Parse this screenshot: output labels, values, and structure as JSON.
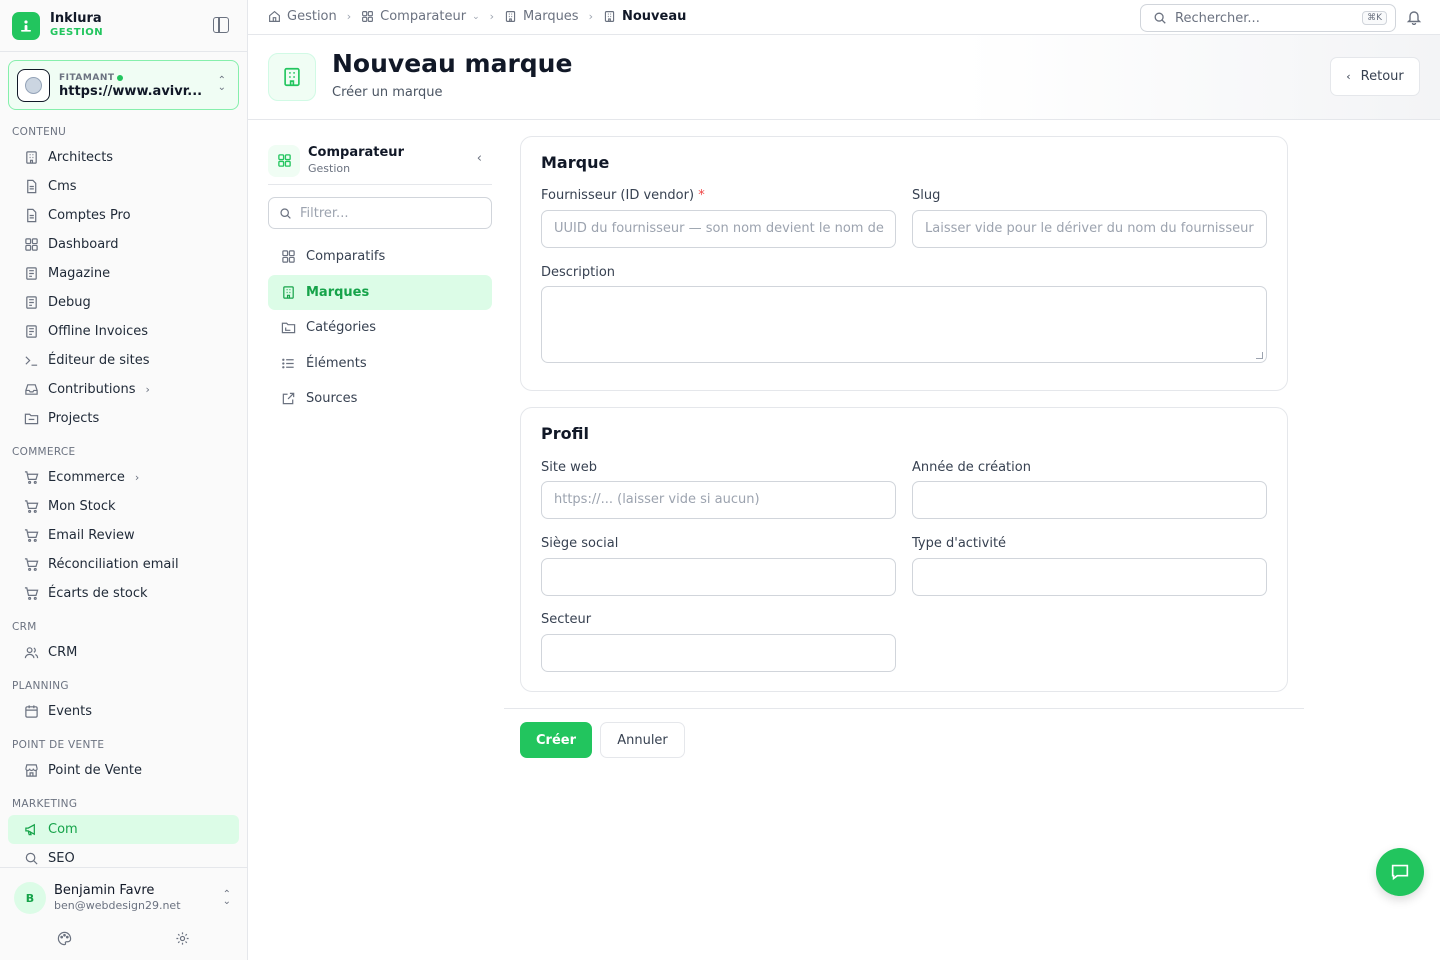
{
  "brand": {
    "name": "Inklura",
    "sub": "GESTION"
  },
  "tenant": {
    "label": "FITAMANT",
    "url": "https://www.avivr..."
  },
  "sidebar": {
    "sections": [
      {
        "label": "CONTENU",
        "items": [
          {
            "label": "Architects",
            "icon": "building-icon"
          },
          {
            "label": "Cms",
            "icon": "file-icon"
          },
          {
            "label": "Comptes Pro",
            "icon": "file-icon"
          },
          {
            "label": "Dashboard",
            "icon": "grid-icon"
          },
          {
            "label": "Magazine",
            "icon": "newspaper-icon"
          },
          {
            "label": "Debug",
            "icon": "newspaper-icon"
          },
          {
            "label": "Offline Invoices",
            "icon": "newspaper-icon"
          },
          {
            "label": "Éditeur de sites",
            "icon": "terminal-icon"
          },
          {
            "label": "Contributions",
            "icon": "inbox-icon",
            "has_children": true
          },
          {
            "label": "Projects",
            "icon": "folder-icon"
          }
        ]
      },
      {
        "label": "COMMERCE",
        "items": [
          {
            "label": "Ecommerce",
            "icon": "cart-icon",
            "has_children": true
          },
          {
            "label": "Mon Stock",
            "icon": "cart-icon"
          },
          {
            "label": "Email Review",
            "icon": "cart-icon"
          },
          {
            "label": "Réconciliation email",
            "icon": "cart-icon"
          },
          {
            "label": "Écarts de stock",
            "icon": "cart-icon"
          }
        ]
      },
      {
        "label": "CRM",
        "items": [
          {
            "label": "CRM",
            "icon": "users-icon"
          }
        ]
      },
      {
        "label": "PLANNING",
        "items": [
          {
            "label": "Events",
            "icon": "calendar-icon"
          }
        ]
      },
      {
        "label": "POINT DE VENTE",
        "items": [
          {
            "label": "Point de Vente",
            "icon": "store-icon"
          }
        ]
      },
      {
        "label": "MARKETING",
        "items": [
          {
            "label": "Com",
            "icon": "megaphone-icon",
            "active": true
          },
          {
            "label": "SEO",
            "icon": "search-icon"
          }
        ]
      }
    ]
  },
  "user": {
    "initial": "B",
    "name": "Benjamin Favre",
    "email": "ben@webdesign29.net"
  },
  "breadcrumb": {
    "items": [
      "Gestion",
      "Comparateur",
      "Marques",
      "Nouveau"
    ]
  },
  "search": {
    "placeholder": "Rechercher...",
    "shortcut": "⌘K"
  },
  "page": {
    "title": "Nouveau marque",
    "subtitle": "Créer un marque",
    "back_label": "Retour"
  },
  "subnav": {
    "title": "Comparateur",
    "subtitle": "Gestion",
    "filter_placeholder": "Filtrer...",
    "items": [
      {
        "label": "Comparatifs",
        "icon": "grid-icon"
      },
      {
        "label": "Marques",
        "icon": "building-icon",
        "active": true
      },
      {
        "label": "Catégories",
        "icon": "folder-tree-icon"
      },
      {
        "label": "Éléments",
        "icon": "list-icon"
      },
      {
        "label": "Sources",
        "icon": "external-link-icon"
      }
    ]
  },
  "form": {
    "marque": {
      "title": "Marque",
      "vendor_label": "Fournisseur (ID vendor)",
      "vendor_required": "*",
      "vendor_placeholder": "UUID du fournisseur — son nom devient le nom de",
      "slug_label": "Slug",
      "slug_placeholder": "Laisser vide pour le dériver du nom du fournisseur",
      "description_label": "Description"
    },
    "profil": {
      "title": "Profil",
      "site_label": "Site web",
      "site_placeholder": "https://... (laisser vide si aucun)",
      "annee_label": "Année de création",
      "siege_label": "Siège social",
      "type_label": "Type d'activité",
      "secteur_label": "Secteur"
    },
    "submit_label": "Créer",
    "cancel_label": "Annuler"
  },
  "colors": {
    "accent": "#22c55e",
    "accent_bg": "#dcfce7",
    "required": "#ef4444"
  }
}
